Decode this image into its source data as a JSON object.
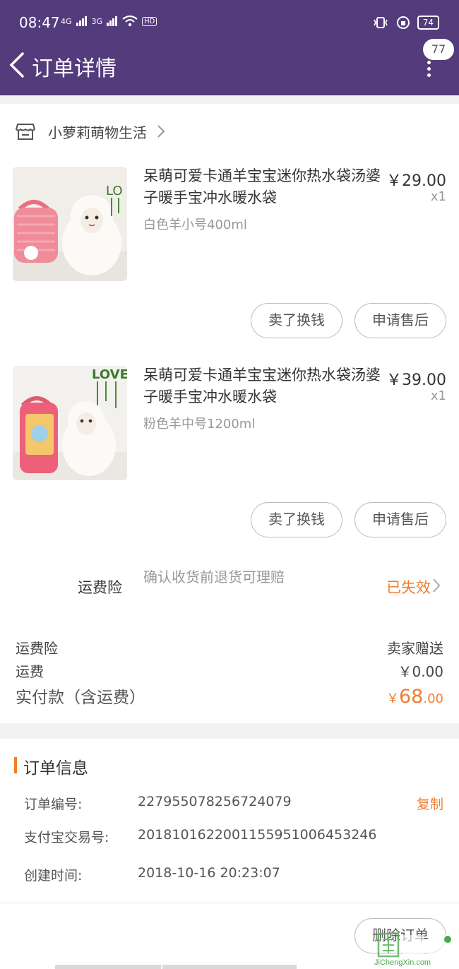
{
  "status_bar": {
    "time": "08:47",
    "network_1": "4G",
    "network_2": "3G",
    "hd": "HD",
    "battery": "74"
  },
  "header": {
    "title": "订单详情",
    "message_count": "77"
  },
  "shop": {
    "name": "小萝莉萌物生活"
  },
  "products": [
    {
      "title": "呆萌可爱卡通羊宝宝迷你热水袋汤婆子暖手宝冲水暖水袋",
      "sku": "白色羊小号400ml",
      "price": "￥29.00",
      "qty": "x1",
      "sell_button": "卖了换钱",
      "aftersale_button": "申请售后"
    },
    {
      "title": "呆萌可爱卡通羊宝宝迷你热水袋汤婆子暖手宝冲水暖水袋",
      "sku": "粉色羊中号1200ml",
      "price": "￥39.00",
      "qty": "x1",
      "sell_button": "卖了换钱",
      "aftersale_button": "申请售后"
    }
  ],
  "insurance": {
    "label": "运费险",
    "description": "确认收货前退货可理赔",
    "status": "已失效"
  },
  "summary": {
    "insurance_label": "运费险",
    "insurance_value": "卖家赠送",
    "shipping_label": "运费",
    "shipping_value": "￥0.00",
    "total_label": "实付款（含运费）",
    "total_currency": "￥",
    "total_int": "68",
    "total_dec": ".00"
  },
  "order_info": {
    "title": "订单信息",
    "order_no_label": "订单编号:",
    "order_no": "227955078256724079",
    "copy_label": "复制",
    "alipay_label": "支付宝交易号:",
    "alipay_no": "2018101622001155951006453246",
    "created_label": "创建时间:",
    "created_time": "2018-10-16 20:23:07"
  },
  "footer": {
    "delete_button": "删除订单",
    "watermark": "JiChengXin.com"
  },
  "colors": {
    "header_bg": "#543b7c",
    "accent": "#ef7d2e"
  }
}
